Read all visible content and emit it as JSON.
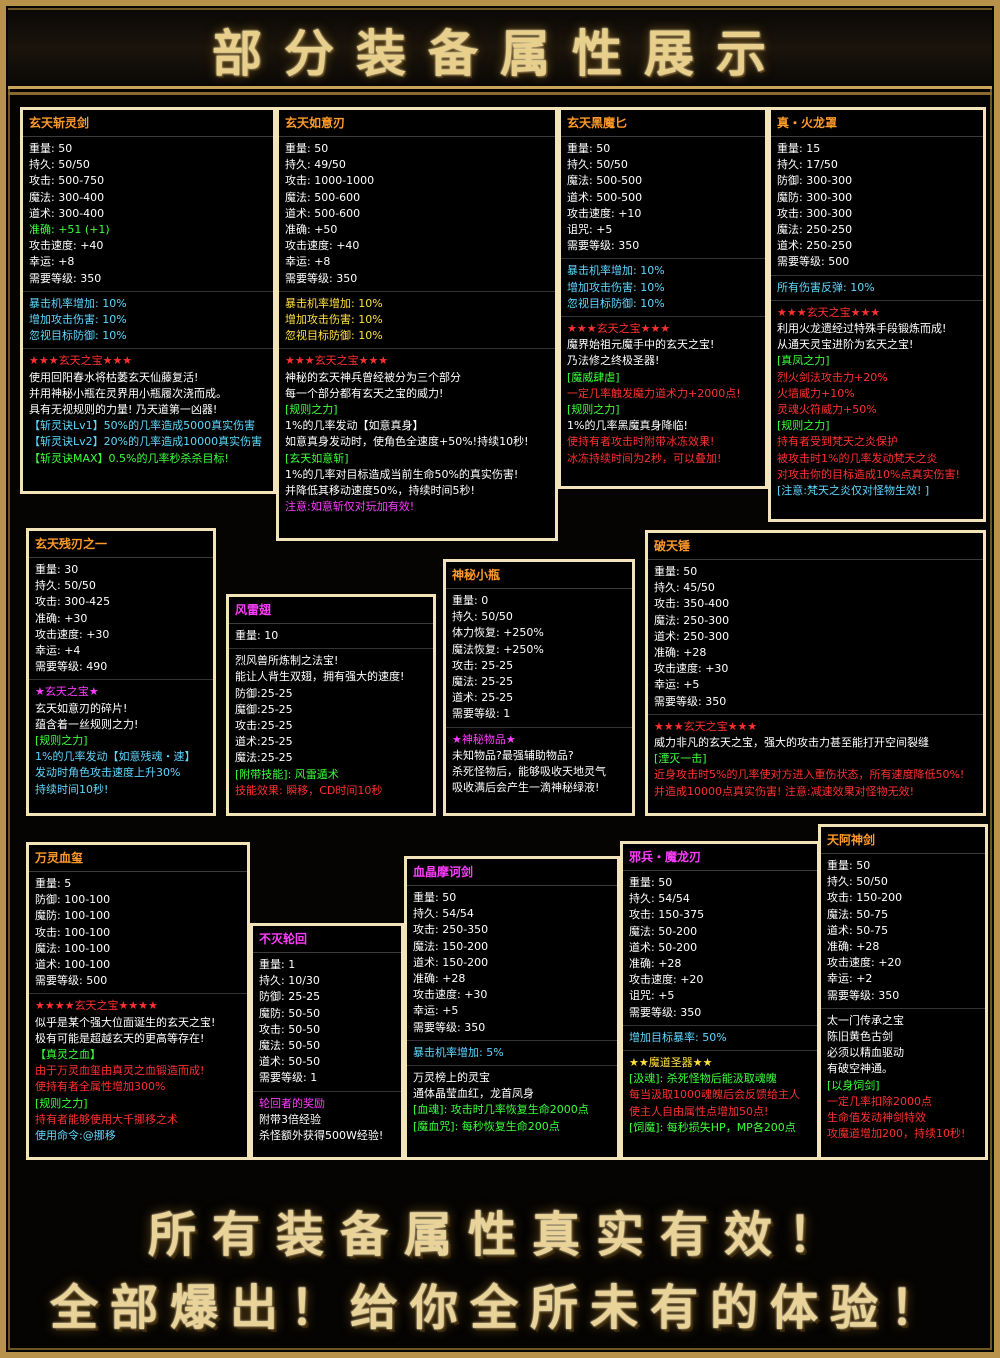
{
  "title": "部分装备属性展示",
  "slogans": [
    "所有装备属性真实有效！",
    "全部爆出！给你全所未有的体验！"
  ],
  "panels": [
    {
      "name": "玄天斩灵剑",
      "name_color": "o",
      "sections": [
        [
          [
            "w",
            "重量: 50"
          ],
          [
            "w",
            "持久: 50/50"
          ],
          [
            "w",
            "攻击: 500-750"
          ],
          [
            "w",
            "魔法: 300-400"
          ],
          [
            "w",
            "道术: 300-400"
          ],
          [
            "g",
            "准确: +51 (+1)"
          ],
          [
            "w",
            "攻击速度: +40"
          ],
          [
            "w",
            "幸运: +8"
          ],
          [
            "w",
            "需要等级: 350"
          ]
        ],
        [
          [
            "c",
            "暴击机率增加: 10%"
          ],
          [
            "c",
            "增加攻击伤害: 10%"
          ],
          [
            "c",
            "忽视目标防御: 10%"
          ]
        ],
        [
          [
            "r",
            "★★★玄天之宝★★★"
          ],
          [
            "w",
            "使用回阳春水将枯萎玄天仙藤复活!"
          ],
          [
            "w",
            "并用神秘小瓶在灵界用小瓶履次浇而成。"
          ],
          [
            "w",
            "具有无视规则的力量! 乃天道第一凶器!"
          ],
          [
            "c",
            "【斩灵诀Lv1】50%的几率造成5000真实伤害"
          ],
          [
            "c",
            "【斩灵诀Lv2】20%的几率造成10000真实伤害"
          ],
          [
            "g",
            "【斩灵诀MAX】0.5%的几率秒杀杀目标!"
          ]
        ]
      ]
    },
    {
      "name": "玄天如意刃",
      "name_color": "o",
      "sections": [
        [
          [
            "w",
            "重量: 50"
          ],
          [
            "w",
            "持久: 49/50"
          ],
          [
            "w",
            "攻击: 1000-1000"
          ],
          [
            "w",
            "魔法: 500-600"
          ],
          [
            "w",
            "道术: 500-600"
          ],
          [
            "w",
            "准确: +50"
          ],
          [
            "w",
            "攻击速度: +40"
          ],
          [
            "w",
            "幸运: +8"
          ],
          [
            "w",
            "需要等级: 350"
          ]
        ],
        [
          [
            "y",
            "暴击机率增加: 10%"
          ],
          [
            "y",
            "增加攻击伤害: 10%"
          ],
          [
            "y",
            "忽视目标防御: 10%"
          ]
        ],
        [
          [
            "r",
            "★★★玄天之宝★★★"
          ],
          [
            "w",
            "神秘的玄天神兵曾经被分为三个部分"
          ],
          [
            "w",
            "每一个部分都有玄天之宝的威力!"
          ],
          [
            "g",
            "[规则之力]"
          ],
          [
            "w",
            "1%的几率发动【如意真身】"
          ],
          [
            "w",
            "如意真身发动时，使角色全速度+50%!持续10秒!"
          ],
          [
            "g",
            "[玄天如意斩]"
          ],
          [
            "w",
            "1%的几率对目标造成当前生命50%的真实伤害!"
          ],
          [
            "w",
            "并降低其移动速度50%，持续时间5秒!"
          ],
          [
            "m",
            "注意:如意斩仅对玩加有效!"
          ]
        ]
      ]
    },
    {
      "name": "玄天黑魔匕",
      "name_color": "o",
      "sections": [
        [
          [
            "w",
            "重量: 50"
          ],
          [
            "w",
            "持久: 50/50"
          ],
          [
            "w",
            "魔法: 500-500"
          ],
          [
            "w",
            "道术: 500-500"
          ],
          [
            "w",
            "攻击速度: +10"
          ],
          [
            "w",
            "诅咒: +5"
          ],
          [
            "w",
            "需要等级: 350"
          ]
        ],
        [
          [
            "c",
            "暴击机率增加: 10%"
          ],
          [
            "c",
            "增加攻击伤害: 10%"
          ],
          [
            "c",
            "忽视目标防御: 10%"
          ]
        ],
        [
          [
            "r",
            "★★★玄天之宝★★★"
          ],
          [
            "w",
            "魔界始祖元魔手中的玄天之宝!"
          ],
          [
            "w",
            "乃法修之终极圣器!"
          ],
          [
            "g",
            "[魔威肆虐]"
          ],
          [
            "r",
            "一定几率触发魔力道术力+2000点!"
          ],
          [
            "g",
            "[规则之力]"
          ],
          [
            "w",
            "1%的几率黑魔真身降临!"
          ],
          [
            "r",
            "使持有者攻击时附带冰冻效果!"
          ],
          [
            "r",
            "冰冻持续时间为2秒，可以叠加!"
          ]
        ]
      ]
    },
    {
      "name": "真・火龙罩",
      "name_color": "o",
      "sections": [
        [
          [
            "w",
            "重量: 15"
          ],
          [
            "w",
            "持久: 17/50"
          ],
          [
            "w",
            "防御: 300-300"
          ],
          [
            "w",
            "魔防: 300-300"
          ],
          [
            "w",
            "攻击: 300-300"
          ],
          [
            "w",
            "魔法: 250-250"
          ],
          [
            "w",
            "道术: 250-250"
          ],
          [
            "w",
            "需要等级: 500"
          ]
        ],
        [
          [
            "c",
            "所有伤害反弹: 10%"
          ]
        ],
        [
          [
            "r",
            "★★★玄天之宝★★★"
          ],
          [
            "w",
            "利用火龙遗经过特殊手段锻炼而成!"
          ],
          [
            "w",
            "从通天灵宝进阶为玄天之宝!"
          ],
          [
            "g",
            "[真凤之力]"
          ],
          [
            "r",
            "烈火剑法攻击力+20%"
          ],
          [
            "r",
            "火墙威力+10%"
          ],
          [
            "r",
            "灵魂火符威力+50%"
          ],
          [
            "g",
            "[规则之力]"
          ],
          [
            "r",
            "持有者受到梵天之炎保护"
          ],
          [
            "r",
            "被攻击时1%的几率发动梵天之炎"
          ],
          [
            "r",
            "对攻击你的目标造成10%点真实伤害!"
          ],
          [
            "c",
            "[注意:梵天之炎仅对怪物生效! ]"
          ]
        ]
      ]
    },
    {
      "name": "玄天残刃之一",
      "name_color": "o",
      "sections": [
        [
          [
            "w",
            "重量: 30"
          ],
          [
            "w",
            "持久: 50/50"
          ],
          [
            "w",
            "攻击: 300-425"
          ],
          [
            "w",
            "准确: +30"
          ],
          [
            "w",
            "攻击速度: +30"
          ],
          [
            "w",
            "幸运: +4"
          ],
          [
            "w",
            "需要等级: 490"
          ]
        ],
        [
          [
            "m",
            "★玄天之宝★"
          ],
          [
            "w",
            "玄天如意刃的碎片!"
          ],
          [
            "w",
            "蕴含着一丝规则之力!"
          ],
          [
            "g",
            "[规则之力]"
          ],
          [
            "c",
            "1%的几率发动【如意残魂・速】"
          ],
          [
            "c",
            "发动时角色攻击速度上升30%"
          ],
          [
            "c",
            "持续时间10秒!"
          ]
        ]
      ]
    },
    {
      "name": "风雷翅",
      "name_color": "m",
      "sections": [
        [
          [
            "w",
            "重量: 10"
          ]
        ],
        [
          [
            "w",
            "烈风兽所炼制之法宝!"
          ],
          [
            "w",
            "能让人背生双翅，拥有强大的速度!"
          ],
          [
            "w",
            "防御:25-25"
          ],
          [
            "w",
            "魔御:25-25"
          ],
          [
            "w",
            "攻击:25-25"
          ],
          [
            "w",
            "道术:25-25"
          ],
          [
            "w",
            "魔法:25-25"
          ],
          [
            "g",
            "[附带技能]: 风雷遁术"
          ],
          [
            "r",
            "技能效果: 瞬移，CD时间10秒"
          ]
        ]
      ]
    },
    {
      "name": "神秘小瓶",
      "name_color": "o",
      "sections": [
        [
          [
            "w",
            "重量: 0"
          ],
          [
            "w",
            "持久: 50/50"
          ],
          [
            "w",
            "体力恢复: +250%"
          ],
          [
            "w",
            "魔法恢复: +250%"
          ],
          [
            "w",
            "攻击: 25-25"
          ],
          [
            "w",
            "魔法: 25-25"
          ],
          [
            "w",
            "道术: 25-25"
          ],
          [
            "w",
            "需要等级: 1"
          ]
        ],
        [
          [
            "m",
            "★神秘物品★"
          ],
          [
            "w",
            "未知物品?最强辅助物品?"
          ],
          [
            "w",
            "杀死怪物后，能够吸收天地灵气"
          ],
          [
            "w",
            "吸收满后会产生一滴神秘绿液!"
          ]
        ]
      ]
    },
    {
      "name": "破天锤",
      "name_color": "o",
      "sections": [
        [
          [
            "w",
            "重量: 50"
          ],
          [
            "w",
            "持久: 45/50"
          ],
          [
            "w",
            "攻击: 350-400"
          ],
          [
            "w",
            "魔法: 250-300"
          ],
          [
            "w",
            "道术: 250-300"
          ],
          [
            "w",
            "准确: +28"
          ],
          [
            "w",
            "攻击速度: +30"
          ],
          [
            "w",
            "幸运: +5"
          ],
          [
            "w",
            "需要等级: 350"
          ]
        ],
        [
          [
            "r",
            "★★★玄天之宝★★★"
          ],
          [
            "w",
            "威力非凡的玄天之宝，强大的攻击力甚至能打开空间裂缝"
          ],
          [
            "g",
            "[湮灭一击]"
          ],
          [
            "r",
            "近身攻击时5%的几率使对方进入重伤状态，所有速度降低50%!"
          ],
          [
            "r",
            "并造成10000点真实伤害! 注意:减速效果对怪物无效!"
          ]
        ]
      ]
    },
    {
      "name": "万灵血玺",
      "name_color": "o",
      "sections": [
        [
          [
            "w",
            "重量: 5"
          ],
          [
            "w",
            "防御: 100-100"
          ],
          [
            "w",
            "魔防: 100-100"
          ],
          [
            "w",
            "攻击: 100-100"
          ],
          [
            "w",
            "魔法: 100-100"
          ],
          [
            "w",
            "道术: 100-100"
          ],
          [
            "w",
            "需要等级: 500"
          ]
        ],
        [
          [
            "r",
            "★★★★玄天之宝★★★★"
          ],
          [
            "w",
            "似乎是某个强大位面诞生的玄天之宝!"
          ],
          [
            "w",
            "极有可能是超越玄天的更高等存在!"
          ],
          [
            "g",
            "【真灵之血】"
          ],
          [
            "r",
            "由于万灵血玺由真灵之血锻造而成!"
          ],
          [
            "r",
            "使持有者全属性增加300%"
          ],
          [
            "g",
            "[规则之力]"
          ],
          [
            "r",
            "持有者能够使用大千挪移之术"
          ],
          [
            "c",
            "使用命令:@挪移"
          ]
        ]
      ]
    },
    {
      "name": "不灭轮回",
      "name_color": "m",
      "sections": [
        [
          [
            "w",
            "重量: 1"
          ],
          [
            "w",
            "持久: 10/30"
          ],
          [
            "w",
            "防御: 25-25"
          ],
          [
            "w",
            "魔防: 50-50"
          ],
          [
            "w",
            "攻击: 50-50"
          ],
          [
            "w",
            "魔法: 50-50"
          ],
          [
            "w",
            "道术: 50-50"
          ],
          [
            "w",
            "需要等级: 1"
          ]
        ],
        [
          [
            "m",
            "轮回者的奖励"
          ],
          [
            "w",
            "附带3倍经验"
          ],
          [
            "w",
            "杀怪额外获得500W经验!"
          ]
        ]
      ]
    },
    {
      "name": "血晶摩诃剑",
      "name_color": "m",
      "sections": [
        [
          [
            "w",
            "重量: 50"
          ],
          [
            "w",
            "持久: 54/54"
          ],
          [
            "w",
            "攻击: 250-350"
          ],
          [
            "w",
            "魔法: 150-200"
          ],
          [
            "w",
            "道术: 150-200"
          ],
          [
            "w",
            "准确: +28"
          ],
          [
            "w",
            "攻击速度: +30"
          ],
          [
            "w",
            "幸运: +5"
          ],
          [
            "w",
            "需要等级: 350"
          ]
        ],
        [
          [
            "c",
            "暴击机率增加: 5%"
          ]
        ],
        [
          [
            "w",
            "万灵榜上的灵宝"
          ],
          [
            "w",
            "通体晶莹血红，龙首凤身"
          ],
          [
            "g",
            "[血魂]: 攻击时几率恢复生命2000点"
          ],
          [
            "g",
            "[魔血咒]: 每秒恢复生命200点"
          ]
        ]
      ]
    },
    {
      "name": "邪兵・魔龙刃",
      "name_color": "m",
      "sections": [
        [
          [
            "w",
            "重量: 50"
          ],
          [
            "w",
            "持久: 54/54"
          ],
          [
            "w",
            "攻击: 150-375"
          ],
          [
            "w",
            "魔法: 50-200"
          ],
          [
            "w",
            "道术: 50-200"
          ],
          [
            "w",
            "准确: +28"
          ],
          [
            "w",
            "攻击速度: +20"
          ],
          [
            "w",
            "诅咒: +5"
          ],
          [
            "w",
            "需要等级: 350"
          ]
        ],
        [
          [
            "c",
            "增加目标暴率: 50%"
          ]
        ],
        [
          [
            "y",
            "★★魔道圣器★★"
          ],
          [
            "g",
            "[汲魂]: 杀死怪物后能汲取魂魄"
          ],
          [
            "r",
            "每当汲取1000魂魄后会反馈给主人"
          ],
          [
            "r",
            "使主人自由属性点增加50点!"
          ],
          [
            "g",
            "[饲魔]: 每秒损失HP，MP各200点"
          ]
        ]
      ]
    },
    {
      "name": "天阿神剑",
      "name_color": "o",
      "sections": [
        [
          [
            "w",
            "重量: 50"
          ],
          [
            "w",
            "持久: 50/50"
          ],
          [
            "w",
            "攻击: 150-200"
          ],
          [
            "w",
            "魔法: 50-75"
          ],
          [
            "w",
            "道术: 50-75"
          ],
          [
            "w",
            "准确: +28"
          ],
          [
            "w",
            "攻击速度: +20"
          ],
          [
            "w",
            "幸运: +2"
          ],
          [
            "w",
            "需要等级: 350"
          ]
        ],
        [
          [
            "w",
            "太一门传承之宝"
          ],
          [
            "w",
            "陈旧黄色古剑"
          ],
          [
            "w",
            "必须以精血驱动"
          ],
          [
            "w",
            "有破空神通。"
          ],
          [
            "g",
            "[以身饲剑]"
          ],
          [
            "r",
            "一定几率扣除2000点"
          ],
          [
            "r",
            "生命值发动神剑特效"
          ],
          [
            "r",
            "攻魔道增加200，持续10秒!"
          ]
        ]
      ]
    }
  ]
}
